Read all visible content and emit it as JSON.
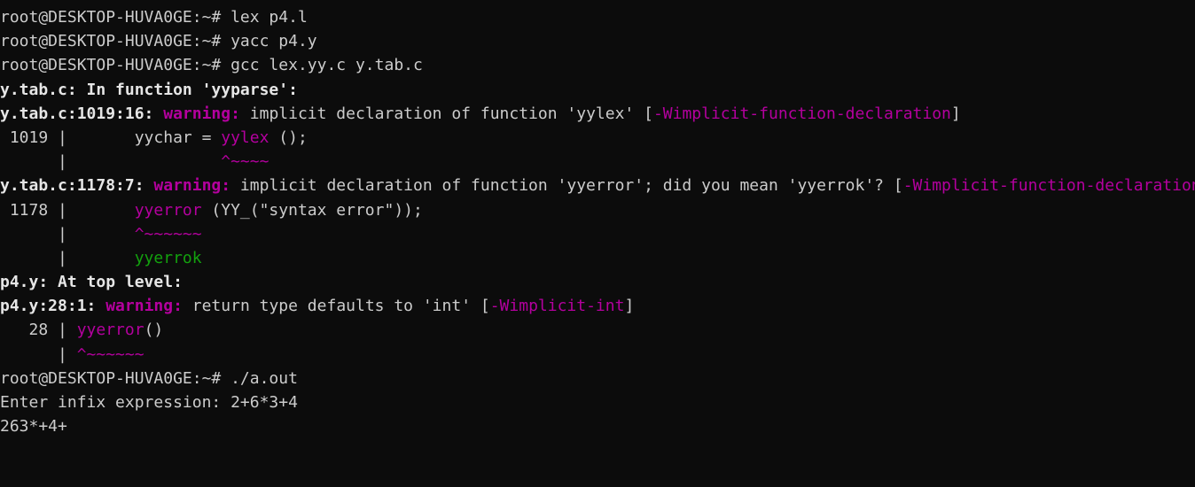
{
  "colors": {
    "background": "#0c0c0c",
    "foreground": "#cccccc",
    "warning": "#b4009e",
    "suggestion": "#13a10e"
  },
  "lines": {
    "l1": {
      "prompt": "root@DESKTOP-HUVA0GE:~#",
      "command": " lex p4.l"
    },
    "l2": {
      "prompt": "root@DESKTOP-HUVA0GE:~#",
      "command": " yacc p4.y"
    },
    "l3": {
      "prompt": "root@DESKTOP-HUVA0GE:~#",
      "command": " gcc lex.yy.c y.tab.c"
    },
    "l4": {
      "text": "y.tab.c: In function 'yyparse':"
    },
    "l5": {
      "loc": "y.tab.c:1019:16: ",
      "level": "warning:",
      "msg": " implicit declaration of function 'yylex' ",
      "flag_open": "[",
      "flag": "-Wimplicit-function-declaration",
      "flag_close": "]"
    },
    "l6": {
      "gutter": " 1019 |",
      "code_pre": "       yychar = ",
      "code_hl": "yylex",
      "code_post": " ();"
    },
    "l7": {
      "gutter": "      |",
      "pad": "                ",
      "caret": "^~~~~"
    },
    "l8": {
      "loc": "y.tab.c:1178:7: ",
      "level": "warning:",
      "msg": " implicit declaration of function 'yyerror'; did you mean 'yyerrok'? ",
      "flag_open": "[",
      "flag": "-Wimplicit-function-declaration",
      "flag_close": "]"
    },
    "l9": {
      "gutter": " 1178 |",
      "code_pre": "       ",
      "code_hl": "yyerror",
      "code_post": " (YY_(\"syntax error\"));"
    },
    "l10": {
      "gutter": "      |",
      "pad": "       ",
      "caret": "^~~~~~~"
    },
    "l11": {
      "gutter": "      |",
      "pad": "       ",
      "suggestion": "yyerrok"
    },
    "l12": {
      "text": "p4.y: At top level:"
    },
    "l13": {
      "loc": "p4.y:28:1: ",
      "level": "warning:",
      "msg": " return type defaults to 'int' ",
      "flag_open": "[",
      "flag": "-Wimplicit-int",
      "flag_close": "]"
    },
    "l14": {
      "gutter": "   28 |",
      "code_pre": " ",
      "code_hl": "yyerror",
      "code_post": "()"
    },
    "l15": {
      "gutter": "      |",
      "pad": " ",
      "caret": "^~~~~~~"
    },
    "l16": {
      "prompt": "root@DESKTOP-HUVA0GE:~#",
      "command": " ./a.out"
    },
    "l17": {
      "text": "Enter infix expression: 2+6*3+4"
    },
    "l18": {
      "text": "263*+4+"
    }
  }
}
